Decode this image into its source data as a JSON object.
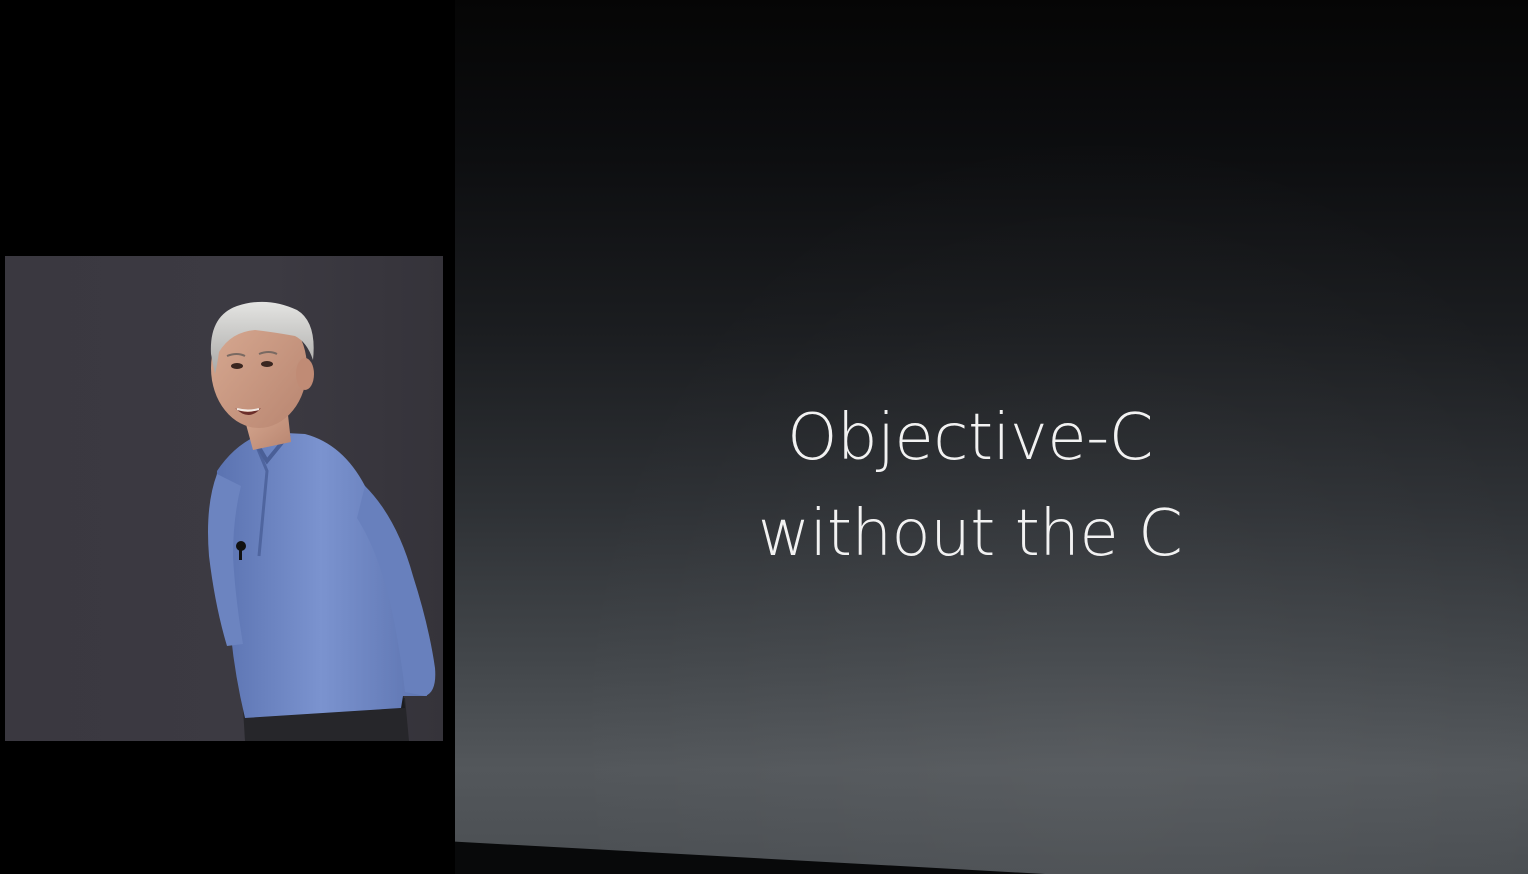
{
  "slide": {
    "line1": "Objective-C",
    "line2": "without the C"
  },
  "colors": {
    "background": "#000000",
    "slide_text": "#f2f2f2",
    "screen_top": "#050505",
    "screen_bottom": "#53575b",
    "inset_background": "#3a3840",
    "shirt": "#6d86c4"
  },
  "inset": {
    "content": "presenter-video"
  }
}
